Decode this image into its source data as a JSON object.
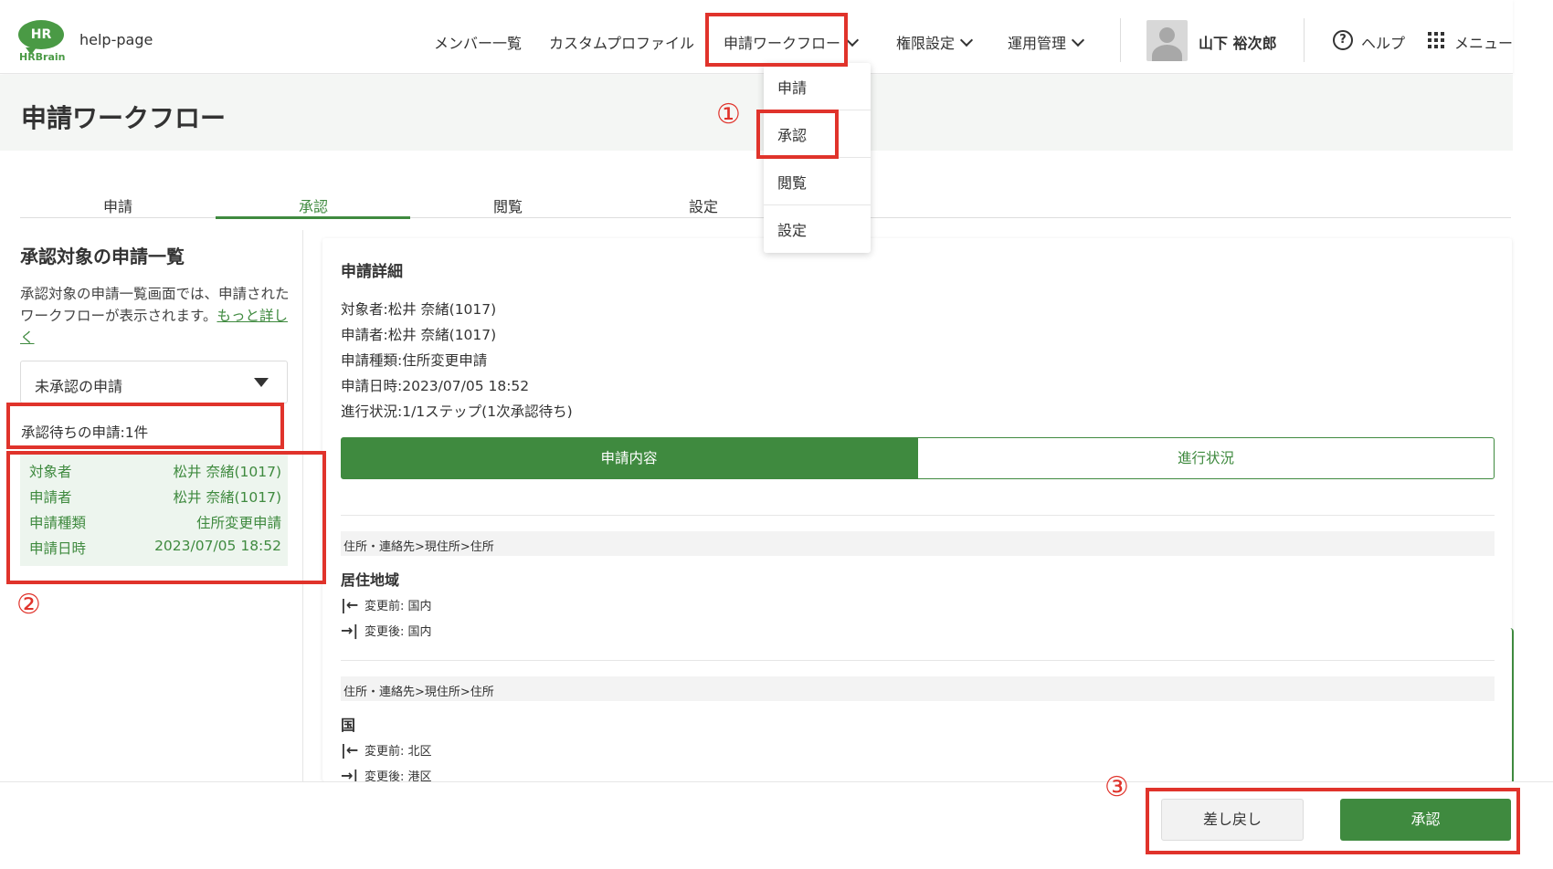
{
  "header": {
    "logo_mark": "HR",
    "logo_text": "HRBrain",
    "site_name": "help-page",
    "nav": [
      "メンバー一覧",
      "カスタムプロファイル",
      "申請ワークフロー",
      "権限設定",
      "運用管理"
    ],
    "user_name": "山下 裕次郎",
    "help_icon": "?",
    "help_label": "ヘルプ",
    "menu_label": "メニュー"
  },
  "page_title": "申請ワークフロー",
  "tabs": [
    "申請",
    "承認",
    "閲覧",
    "設定"
  ],
  "active_tab": "承認",
  "dropdown": [
    "申請",
    "承認",
    "閲覧",
    "設定"
  ],
  "left": {
    "title": "承認対象の申請一覧",
    "description": "承認対象の申請一覧画面では、申請されたワークフローが表示されます。",
    "more_link": "もっと詳しく",
    "filter_value": "未承認の申請",
    "pending_count": "承認待ちの申請:1件",
    "card": {
      "rows": [
        {
          "key": "対象者",
          "value": "松井 奈緒(1017)"
        },
        {
          "key": "申請者",
          "value": "松井 奈緒(1017)"
        },
        {
          "key": "申請種類",
          "value": "住所変更申請"
        },
        {
          "key": "申請日時",
          "value": "2023/07/05 18:52"
        }
      ]
    }
  },
  "detail": {
    "title": "申請詳細",
    "lines": [
      "対象者:松井 奈緒(1017)",
      "申請者:松井 奈緒(1017)",
      "申請種類:住所変更申請",
      "申請日時:2023/07/05 18:52",
      "進行状況:1/1ステップ(1次承認待ち)"
    ],
    "seg_left": "申請内容",
    "seg_right": "進行状況",
    "changes": [
      {
        "path": "住所・連絡先>現住所>住所",
        "field": "居住地域",
        "before_arrow": "|←",
        "before": "変更前: 国内",
        "after_arrow": "→|",
        "after": "変更後: 国内"
      },
      {
        "path": "住所・連絡先>現住所>住所",
        "field": "国",
        "before_arrow": "|←",
        "before": "変更前: 北区",
        "after_arrow": "→|",
        "after": "変更後: 港区"
      }
    ]
  },
  "footer": {
    "reject_label": "差し戻し",
    "approve_label": "承認"
  },
  "annotations": [
    "①",
    "②",
    "③"
  ],
  "colors": {
    "accent": "#3f8a3f",
    "annotation": "#e0332b",
    "card_bg": "#edf5ee"
  }
}
